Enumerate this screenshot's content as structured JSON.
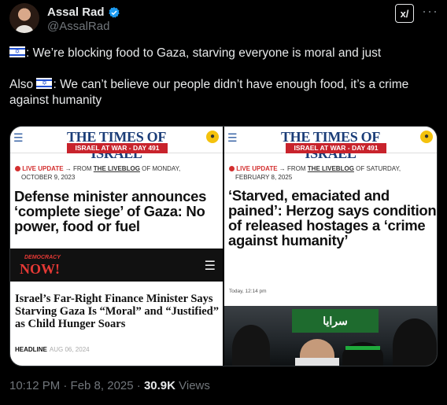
{
  "author": {
    "name": "Assal Rad",
    "handle": "@AssalRad"
  },
  "header": {
    "grok_label": "x/"
  },
  "tweet": {
    "line1": ": We’re blocking food to Gaza, starving everyone is moral and just",
    "line2_prefix": "Also ",
    "line2": ": We can’t believe our people didn’t have enough food, it’s a crime against humanity"
  },
  "media": {
    "left": {
      "logo": "THE TIMES OF ISRAEL",
      "banner": "ISRAEL AT WAR - DAY 491",
      "live_label": "LIVE UPDATE",
      "live_from": "→ FROM",
      "live_blog": "THE LIVEBLOG",
      "live_of": "OF MONDAY,",
      "live_date": "OCTOBER 9, 2023",
      "headline": "Defense minister announces ‘complete siege’ of Gaza: No power, food or fuel",
      "dn_top": "DEMOCRACY",
      "dn_logo": "NOW!",
      "dn_headline": "Israel’s Far-Right Finance Minister Says Starving Gaza Is “Moral” and “Justified” as Child Hunger Soars",
      "dn_kicker": "HEADLINE",
      "dn_date": "AUG 06, 2024"
    },
    "right": {
      "logo": "THE TIMES OF ISRAEL",
      "banner": "ISRAEL AT WAR - DAY 491",
      "live_label": "LIVE UPDATE",
      "live_from": "→ FROM",
      "live_blog": "THE LIVEBLOG",
      "live_of": "OF SATURDAY,",
      "live_date": "FEBRUARY 8, 2025",
      "headline": "‘Starved, emaciated and pained’: Herzog says condition of released hostages a ‘crime against humanity’",
      "photo_meta": "Today, 12:14 pm",
      "photo_banner": "سرايا"
    }
  },
  "footer": {
    "time": "10:12 PM · Feb 8, 2025 · ",
    "views_count": "30.9K",
    "views_label": " Views"
  },
  "colors": {
    "verified": "#1d9bf0",
    "toi_blue": "#1b3d78",
    "war_red": "#c8232c"
  }
}
